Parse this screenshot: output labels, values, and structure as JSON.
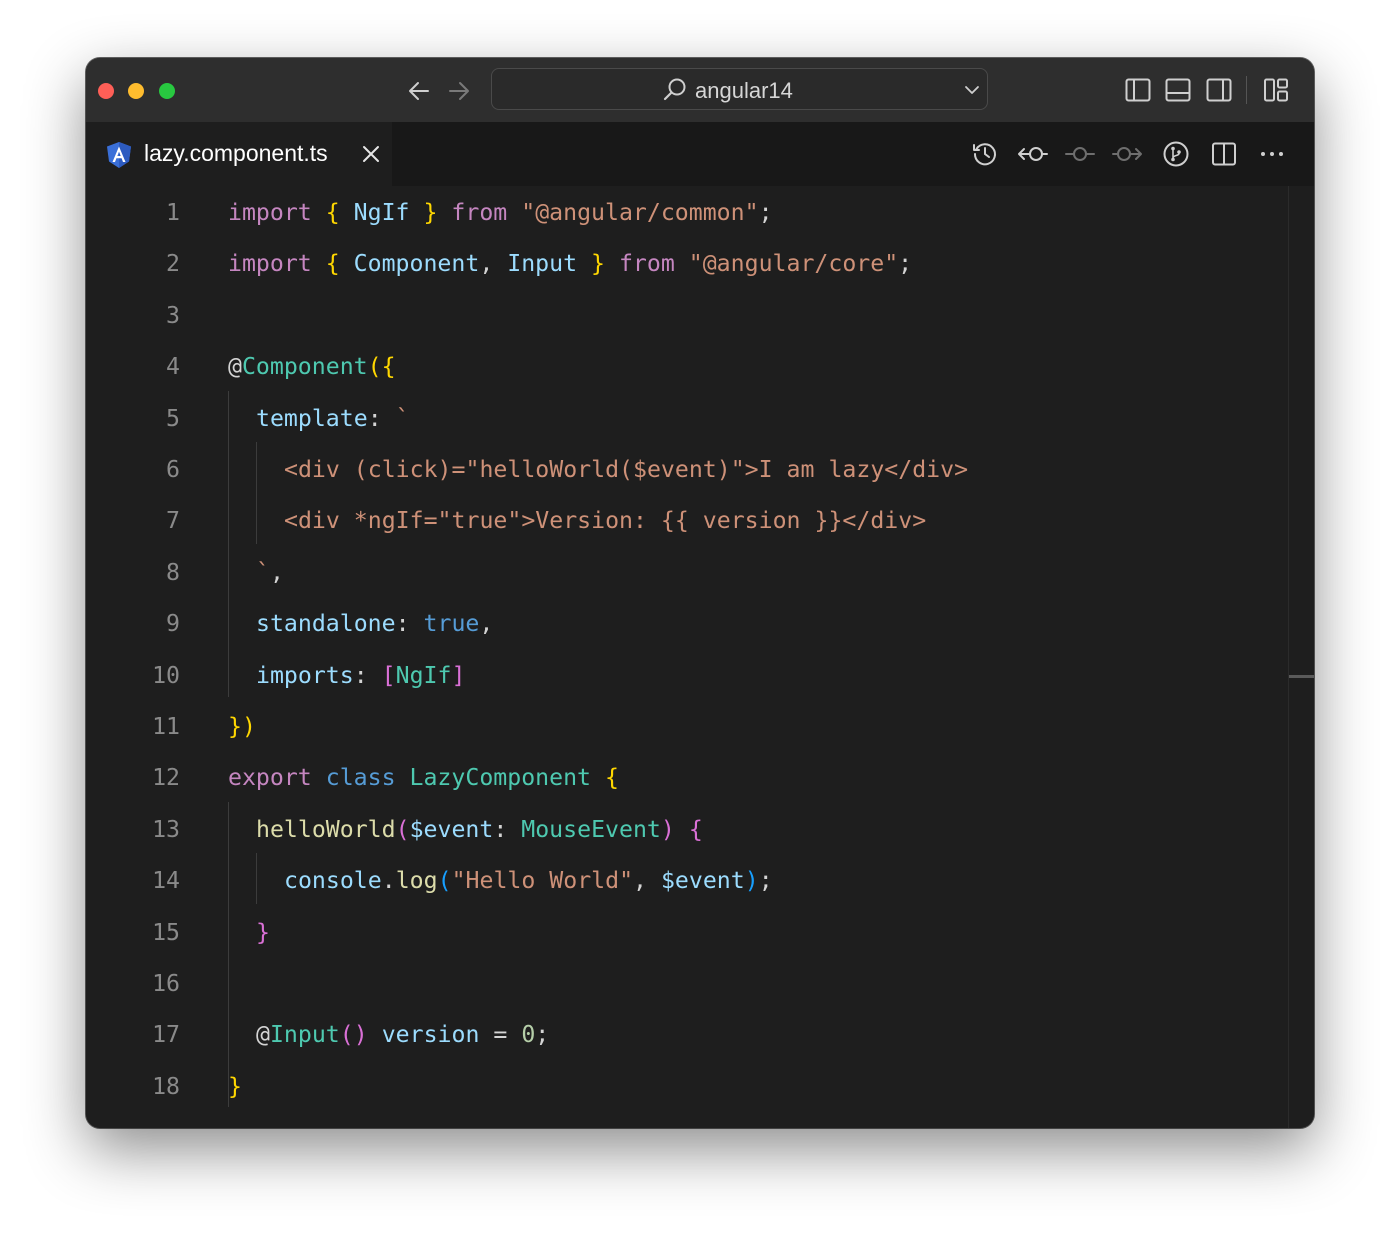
{
  "window": {
    "search_label": "angular14",
    "tab_title": "lazy.component.ts",
    "tab_icon": "angular-icon",
    "accent": "#dd0031"
  },
  "toolbar": {
    "nav": [
      "arrow-left-icon",
      "arrow-right-icon"
    ],
    "layout": [
      "toggle-primary-sidebar-icon",
      "toggle-panel-icon",
      "toggle-secondary-sidebar-icon",
      "customize-layout-icon"
    ],
    "editor_actions": [
      "timeline-history-icon",
      "go-back-commit-icon",
      "commit-icon",
      "go-forward-commit-icon",
      "source-control-graph-icon",
      "split-editor-icon",
      "more-actions-icon"
    ]
  },
  "editor": {
    "language": "typescript",
    "lines": [
      {
        "n": "1",
        "indent": 0,
        "tokens": [
          {
            "t": "import",
            "c": "kw"
          },
          {
            "t": " "
          },
          {
            "t": "{",
            "c": "b1"
          },
          {
            "t": " "
          },
          {
            "t": "NgIf",
            "c": "var"
          },
          {
            "t": " "
          },
          {
            "t": "}",
            "c": "b1"
          },
          {
            "t": " "
          },
          {
            "t": "from",
            "c": "kw"
          },
          {
            "t": " "
          },
          {
            "t": "\"@angular/common\"",
            "c": "str"
          },
          {
            "t": ";",
            "c": "pun"
          }
        ]
      },
      {
        "n": "2",
        "indent": 0,
        "tokens": [
          {
            "t": "import",
            "c": "kw"
          },
          {
            "t": " "
          },
          {
            "t": "{",
            "c": "b1"
          },
          {
            "t": " "
          },
          {
            "t": "Component",
            "c": "var"
          },
          {
            "t": ", ",
            "c": "pun"
          },
          {
            "t": "Input",
            "c": "var"
          },
          {
            "t": " "
          },
          {
            "t": "}",
            "c": "b1"
          },
          {
            "t": " "
          },
          {
            "t": "from",
            "c": "kw"
          },
          {
            "t": " "
          },
          {
            "t": "\"@angular/core\"",
            "c": "str"
          },
          {
            "t": ";",
            "c": "pun"
          }
        ]
      },
      {
        "n": "3",
        "indent": 0,
        "tokens": []
      },
      {
        "n": "4",
        "indent": 0,
        "tokens": [
          {
            "t": "@",
            "c": "pun"
          },
          {
            "t": "Component",
            "c": "typ"
          },
          {
            "t": "(",
            "c": "b1"
          },
          {
            "t": "{",
            "c": "b1"
          }
        ]
      },
      {
        "n": "5",
        "indent": 1,
        "tokens": [
          {
            "t": "template",
            "c": "var"
          },
          {
            "t": ": ",
            "c": "pun"
          },
          {
            "t": "`",
            "c": "str"
          }
        ]
      },
      {
        "n": "6",
        "indent": 2,
        "tokens": [
          {
            "t": "<div (click)=\"helloWorld($event)\">I am lazy</div>",
            "c": "str"
          }
        ]
      },
      {
        "n": "7",
        "indent": 2,
        "tokens": [
          {
            "t": "<div *ngIf=\"true\">Version: {{ version }}</div>",
            "c": "str"
          }
        ]
      },
      {
        "n": "8",
        "indent": 1,
        "tokens": [
          {
            "t": "`",
            "c": "str"
          },
          {
            "t": ",",
            "c": "pun"
          }
        ]
      },
      {
        "n": "9",
        "indent": 1,
        "tokens": [
          {
            "t": "standalone",
            "c": "var"
          },
          {
            "t": ": ",
            "c": "pun"
          },
          {
            "t": "true",
            "c": "lit"
          },
          {
            "t": ",",
            "c": "pun"
          }
        ]
      },
      {
        "n": "10",
        "indent": 1,
        "tokens": [
          {
            "t": "imports",
            "c": "var"
          },
          {
            "t": ": ",
            "c": "pun"
          },
          {
            "t": "[",
            "c": "b2"
          },
          {
            "t": "NgIf",
            "c": "typ"
          },
          {
            "t": "]",
            "c": "b2"
          }
        ]
      },
      {
        "n": "11",
        "indent": 0,
        "tokens": [
          {
            "t": "}",
            "c": "b1"
          },
          {
            "t": ")",
            "c": "b1"
          }
        ]
      },
      {
        "n": "12",
        "indent": 0,
        "tokens": [
          {
            "t": "export",
            "c": "kw"
          },
          {
            "t": " "
          },
          {
            "t": "class",
            "c": "lit"
          },
          {
            "t": " "
          },
          {
            "t": "LazyComponent",
            "c": "typ"
          },
          {
            "t": " "
          },
          {
            "t": "{",
            "c": "b1"
          }
        ]
      },
      {
        "n": "13",
        "indent": 1,
        "tokens": [
          {
            "t": "helloWorld",
            "c": "fn"
          },
          {
            "t": "(",
            "c": "b2"
          },
          {
            "t": "$event",
            "c": "var"
          },
          {
            "t": ": ",
            "c": "pun"
          },
          {
            "t": "MouseEvent",
            "c": "typ"
          },
          {
            "t": ")",
            "c": "b2"
          },
          {
            "t": " "
          },
          {
            "t": "{",
            "c": "b2"
          }
        ]
      },
      {
        "n": "14",
        "indent": 2,
        "tokens": [
          {
            "t": "console",
            "c": "var"
          },
          {
            "t": ".",
            "c": "pun"
          },
          {
            "t": "log",
            "c": "fn"
          },
          {
            "t": "(",
            "c": "b3"
          },
          {
            "t": "\"Hello World\"",
            "c": "str"
          },
          {
            "t": ", ",
            "c": "pun"
          },
          {
            "t": "$event",
            "c": "var"
          },
          {
            "t": ")",
            "c": "b3"
          },
          {
            "t": ";",
            "c": "pun"
          }
        ]
      },
      {
        "n": "15",
        "indent": 1,
        "tokens": [
          {
            "t": "}",
            "c": "b2"
          }
        ]
      },
      {
        "n": "16",
        "indent": 0,
        "tokens": []
      },
      {
        "n": "17",
        "indent": 1,
        "tokens": [
          {
            "t": "@",
            "c": "pun"
          },
          {
            "t": "Input",
            "c": "typ"
          },
          {
            "t": "(",
            "c": "b2"
          },
          {
            "t": ")",
            "c": "b2"
          },
          {
            "t": " "
          },
          {
            "t": "version",
            "c": "var"
          },
          {
            "t": " = ",
            "c": "pun"
          },
          {
            "t": "0",
            "c": "num"
          },
          {
            "t": ";",
            "c": "pun"
          }
        ]
      },
      {
        "n": "18",
        "indent": 0,
        "tokens": [
          {
            "t": "}",
            "c": "b1"
          }
        ]
      }
    ]
  },
  "colors": {
    "keyword": "#c586c0",
    "string": "#ce9178",
    "variable": "#9cdcfe",
    "type": "#4ec9b0",
    "function": "#dcdcaa",
    "literal": "#569cd6",
    "number": "#b5cea8",
    "bracket_level_1": "#ffd700",
    "bracket_level_2": "#da70d6",
    "bracket_level_3": "#179fff"
  }
}
